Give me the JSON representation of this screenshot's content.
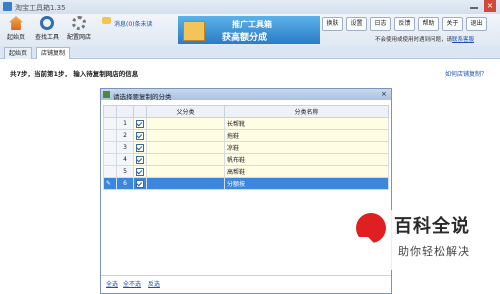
{
  "window": {
    "title": "淘宝工具箱1.35",
    "close_glyph": "×"
  },
  "toolbar": {
    "home": "起始页",
    "find_tool": "查找工具",
    "configure_shop": "配置网店",
    "message_prefix": "消息(",
    "message_count": "0",
    "message_suffix": ")条未读",
    "right_buttons": [
      "换肤",
      "设置",
      "日志",
      "反馈",
      "帮助",
      "关于",
      "退出"
    ],
    "notice_text": "不会使用或使用时遇到问题，请",
    "notice_link": "联系客服"
  },
  "banner": {
    "line1": "推广工具箱",
    "line2": "获高额分成"
  },
  "tabs": [
    "起始页",
    "店铺复制"
  ],
  "step_text": "共7步，当前第1步，  输入待复制网店的信息",
  "help_link": "如何店铺复制？",
  "dialog": {
    "title": "请选择要复制的分类",
    "close": "×",
    "col_parent": "父分类",
    "col_name": "分类名称",
    "rows": [
      {
        "n": "1",
        "parent": "",
        "name": "长帮靴"
      },
      {
        "n": "2",
        "parent": "",
        "name": "拖鞋"
      },
      {
        "n": "3",
        "parent": "",
        "name": "凉鞋"
      },
      {
        "n": "4",
        "parent": "",
        "name": "帆布鞋"
      },
      {
        "n": "5",
        "parent": "",
        "name": "高帮鞋"
      },
      {
        "n": "6",
        "parent": "",
        "name": "分额按"
      }
    ],
    "footer": [
      "全选",
      "全不选",
      "反选"
    ]
  },
  "watermark": {
    "big": "百科全说",
    "small": "助你轻松解决"
  },
  "icons": [
    "home-icon",
    "search-icon",
    "gear-icon",
    "message-icon",
    "edit-pencil-icon",
    "checkbox-icon"
  ],
  "colors": {
    "selected_row": "#3d86dd",
    "row_bg": "#fffde4",
    "link": "#1b4fb0"
  }
}
